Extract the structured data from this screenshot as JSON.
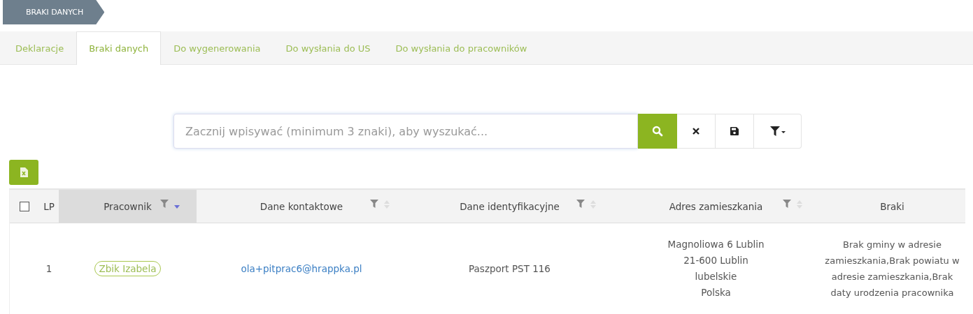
{
  "breadcrumb": "BRAKI DANYCH",
  "tabs": [
    {
      "label": "Deklaracje",
      "selected": false
    },
    {
      "label": "Braki danych",
      "selected": true
    },
    {
      "label": "Do wygenerowania",
      "selected": false
    },
    {
      "label": "Do wysłania do US",
      "selected": false
    },
    {
      "label": "Do wysłania do pracowników",
      "selected": false
    }
  ],
  "search": {
    "placeholder": "Zacznij wpisywać (minimum 3 znaki), aby wyszukać..."
  },
  "table": {
    "select_all_checked": false,
    "columns": [
      {
        "label": "LP",
        "filterable": false,
        "sorted": false
      },
      {
        "label": "Pracownik",
        "filterable": true,
        "sorted": true
      },
      {
        "label": "Dane kontaktowe",
        "filterable": true,
        "sorted": false
      },
      {
        "label": "Dane identyfikacyjne",
        "filterable": true,
        "sorted": false
      },
      {
        "label": "Adres zamieszkania",
        "filterable": true,
        "sorted": false
      },
      {
        "label": "Braki",
        "filterable": false,
        "sorted": false
      }
    ],
    "rows": [
      {
        "lp": "1",
        "employee": "Zbik Izabela",
        "contact": "ola+pitprac6@hrappka.pl",
        "identification": "Paszport PST 116",
        "address": [
          "Magnoliowa 6 Lublin",
          "21-600 Lublin",
          "lubelskie",
          "Polska"
        ],
        "missing": "Brak gminy w adresie zamieszkania,Brak powiatu w adresie zamieszkania,Brak daty urodzenia pracownika"
      }
    ]
  }
}
